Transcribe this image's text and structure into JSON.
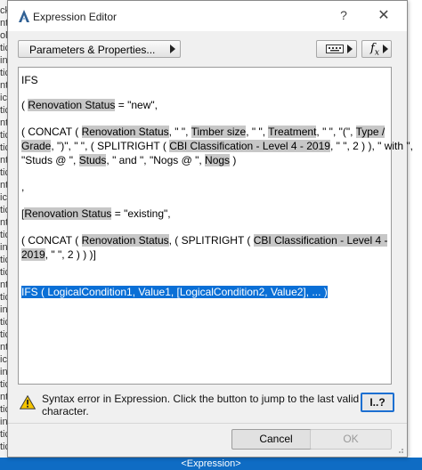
{
  "window": {
    "title": "Expression Editor",
    "help_glyph": "?",
    "close_glyph": "✕",
    "app_icon": "archicad-icon"
  },
  "toolbar": {
    "params_label": "Parameters & Properties...",
    "fx_label": "fx"
  },
  "editor": {
    "lines": [
      [
        {
          "t": "IFS"
        }
      ],
      [
        {
          "t": "( "
        },
        {
          "t": "Renovation Status",
          "h": 1
        },
        {
          "t": " = \"new\","
        }
      ],
      [
        {
          "t": "( CONCAT ( "
        },
        {
          "t": "Renovation Status",
          "h": 1
        },
        {
          "t": ", \" \", "
        },
        {
          "t": "Timber size",
          "h": 1
        },
        {
          "t": ", \" \", "
        },
        {
          "t": "Treatment",
          "h": 1
        },
        {
          "t": ", \" \", \"(\", "
        },
        {
          "t": "Type /",
          "h": 1
        }
      ],
      [
        {
          "t": "Grade",
          "h": 1
        },
        {
          "t": ", \")\", \" \", ( SPLITRIGHT ( "
        },
        {
          "t": "CBI Classification - Level 4 - 2019",
          "h": 1
        },
        {
          "t": ", \" \", 2 ) ), \" with \","
        }
      ],
      [
        {
          "t": "\"Studs @ \", "
        },
        {
          "t": "Studs",
          "h": 1
        },
        {
          "t": ", \" and \", \"Nogs @ \", "
        },
        {
          "t": "Nogs",
          "h": 1
        },
        {
          "t": " )"
        }
      ],
      [
        {
          "t": ","
        }
      ],
      [
        {
          "t": " ["
        },
        {
          "t": "Renovation Status",
          "h": 1
        },
        {
          "t": " = \"existing\","
        }
      ],
      [
        {
          "t": "( CONCAT ( "
        },
        {
          "t": "Renovation Status",
          "h": 1
        },
        {
          "t": ", ( SPLITRIGHT ( "
        },
        {
          "t": "CBI Classification - Level 4 -",
          "h": 1
        }
      ],
      [
        {
          "t": "2019",
          "h": 1
        },
        {
          "t": ", \" \", 2 ) ) )]"
        }
      ],
      [
        {
          "t": " "
        },
        {
          "t": "IFS ( LogicalCondition1, Value1, [LogicalCondition2, Value2], ... )",
          "s": 1
        }
      ]
    ]
  },
  "status": {
    "error_text": "Syntax error in Expression. Click the button to jump to the last valid character.",
    "jump_label": "I..?"
  },
  "buttons": {
    "cancel": "Cancel",
    "ok": "OK"
  },
  "background": {
    "bottom_label": "<Expression>",
    "left_fragments": [
      "ck",
      "nt",
      "olo",
      "tic",
      "ini",
      "tic",
      "nt",
      "ic",
      "tic",
      "nt",
      "tic",
      "tic",
      "nt",
      "tic",
      "nt",
      "ic",
      "tic",
      "nt",
      "tic",
      "ini",
      "tic",
      "tic",
      "nt",
      "tic",
      "ini",
      "tic",
      "tic",
      "nt",
      "ic",
      "ini",
      "tic",
      "nt",
      "tic",
      "ini",
      "tic",
      "tic"
    ]
  },
  "colors": {
    "selection": "#0a6fd6",
    "property_highlight": "#c7c7c7",
    "accent_border": "#1c6fd1",
    "status_bar": "#0f6cc4"
  }
}
